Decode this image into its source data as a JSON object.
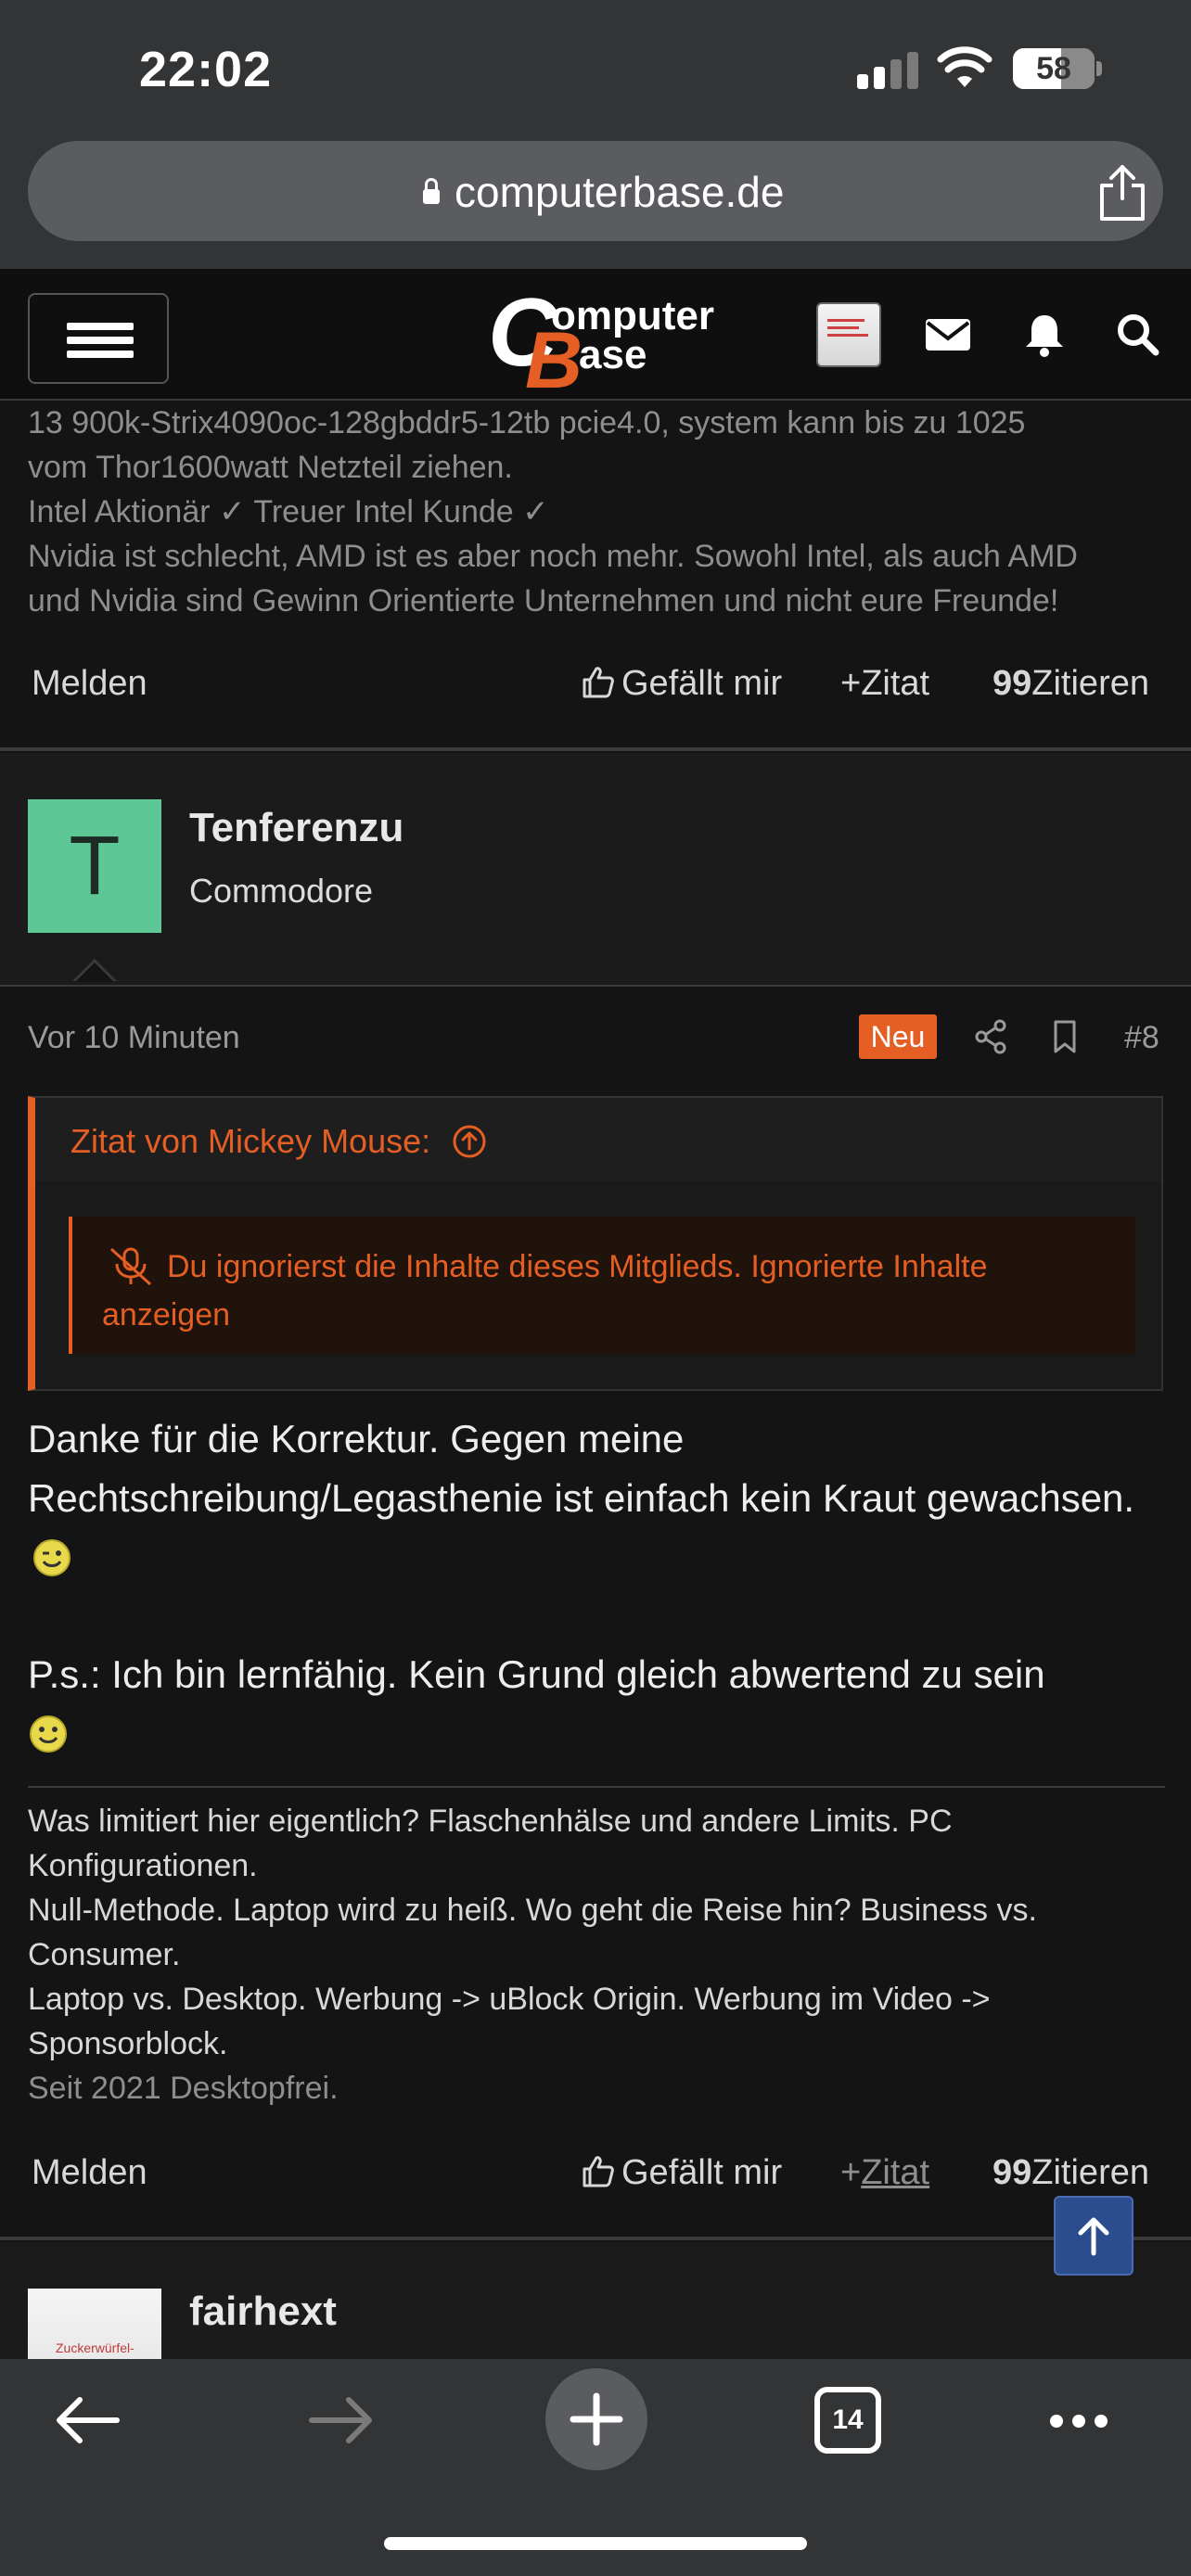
{
  "status_bar": {
    "time": "22:02",
    "battery": "58"
  },
  "browser": {
    "url": "computerbase.de"
  },
  "site": {
    "logo_letter_c": "C",
    "logo_letter_b": "B",
    "logo_word1": "omputer",
    "logo_word2": "ase"
  },
  "prev_post": {
    "signature": [
      "13 900k-Strix4090oc-128gbddr5-12tb pcie4.0, system kann bis zu 1025",
      "vom Thor1600watt Netzteil ziehen.",
      "Intel Aktionär ✓ Treuer Intel Kunde ✓",
      "Nvidia ist schlecht, AMD ist es aber noch mehr. Sowohl Intel, als auch AMD",
      "und Nvidia sind Gewinn Orientierte Unternehmen und nicht eure Freunde!"
    ],
    "actions": {
      "report": "Melden",
      "like": "Gefällt mir",
      "zitat": "Zitat",
      "zitieren": "Zitieren"
    }
  },
  "post": {
    "avatar_letter": "T",
    "username": "Tenferenzu",
    "user_title": "Commodore",
    "time": "Vor 10 Minuten",
    "badge": "Neu",
    "number": "#8",
    "quote_author": "Zitat von Mickey Mouse:",
    "ignored_text": "Du ignorierst die Inhalte dieses Mitglieds.",
    "ignored_link": "Ignorierte Inhalte anzeigen",
    "body_p1": "Danke für die Korrektur. Gegen meine Rechtschreibung/Legasthenie ist einfach kein Kraut gewachsen.",
    "body_p2": "P.s.: Ich bin lernfähig. Kein Grund gleich abwertend zu sein",
    "signature": [
      "Was limitiert hier eigentlich? Flaschenhälse und andere Limits. PC Konfigurationen.",
      "Null-Methode. Laptop wird zu heiß. Wo geht die Reise hin? Business vs. Consumer.",
      "Laptop vs. Desktop. Werbung -> uBlock Origin. Werbung im Video -> Sponsorblock."
    ],
    "signature_faded": "Seit 2021 Desktopfrei.",
    "actions": {
      "report": "Melden",
      "like": "Gefällt mir",
      "zitat": "Zitat",
      "zitieren": "Zitieren"
    }
  },
  "next_post": {
    "username": "fairhext",
    "avatar_text": "Zuckerwürfel-"
  },
  "toolbar": {
    "tab_count": "14"
  },
  "colors": {
    "accent": "#e55e23",
    "avatar_green": "#5ec796",
    "background": "#141414"
  }
}
